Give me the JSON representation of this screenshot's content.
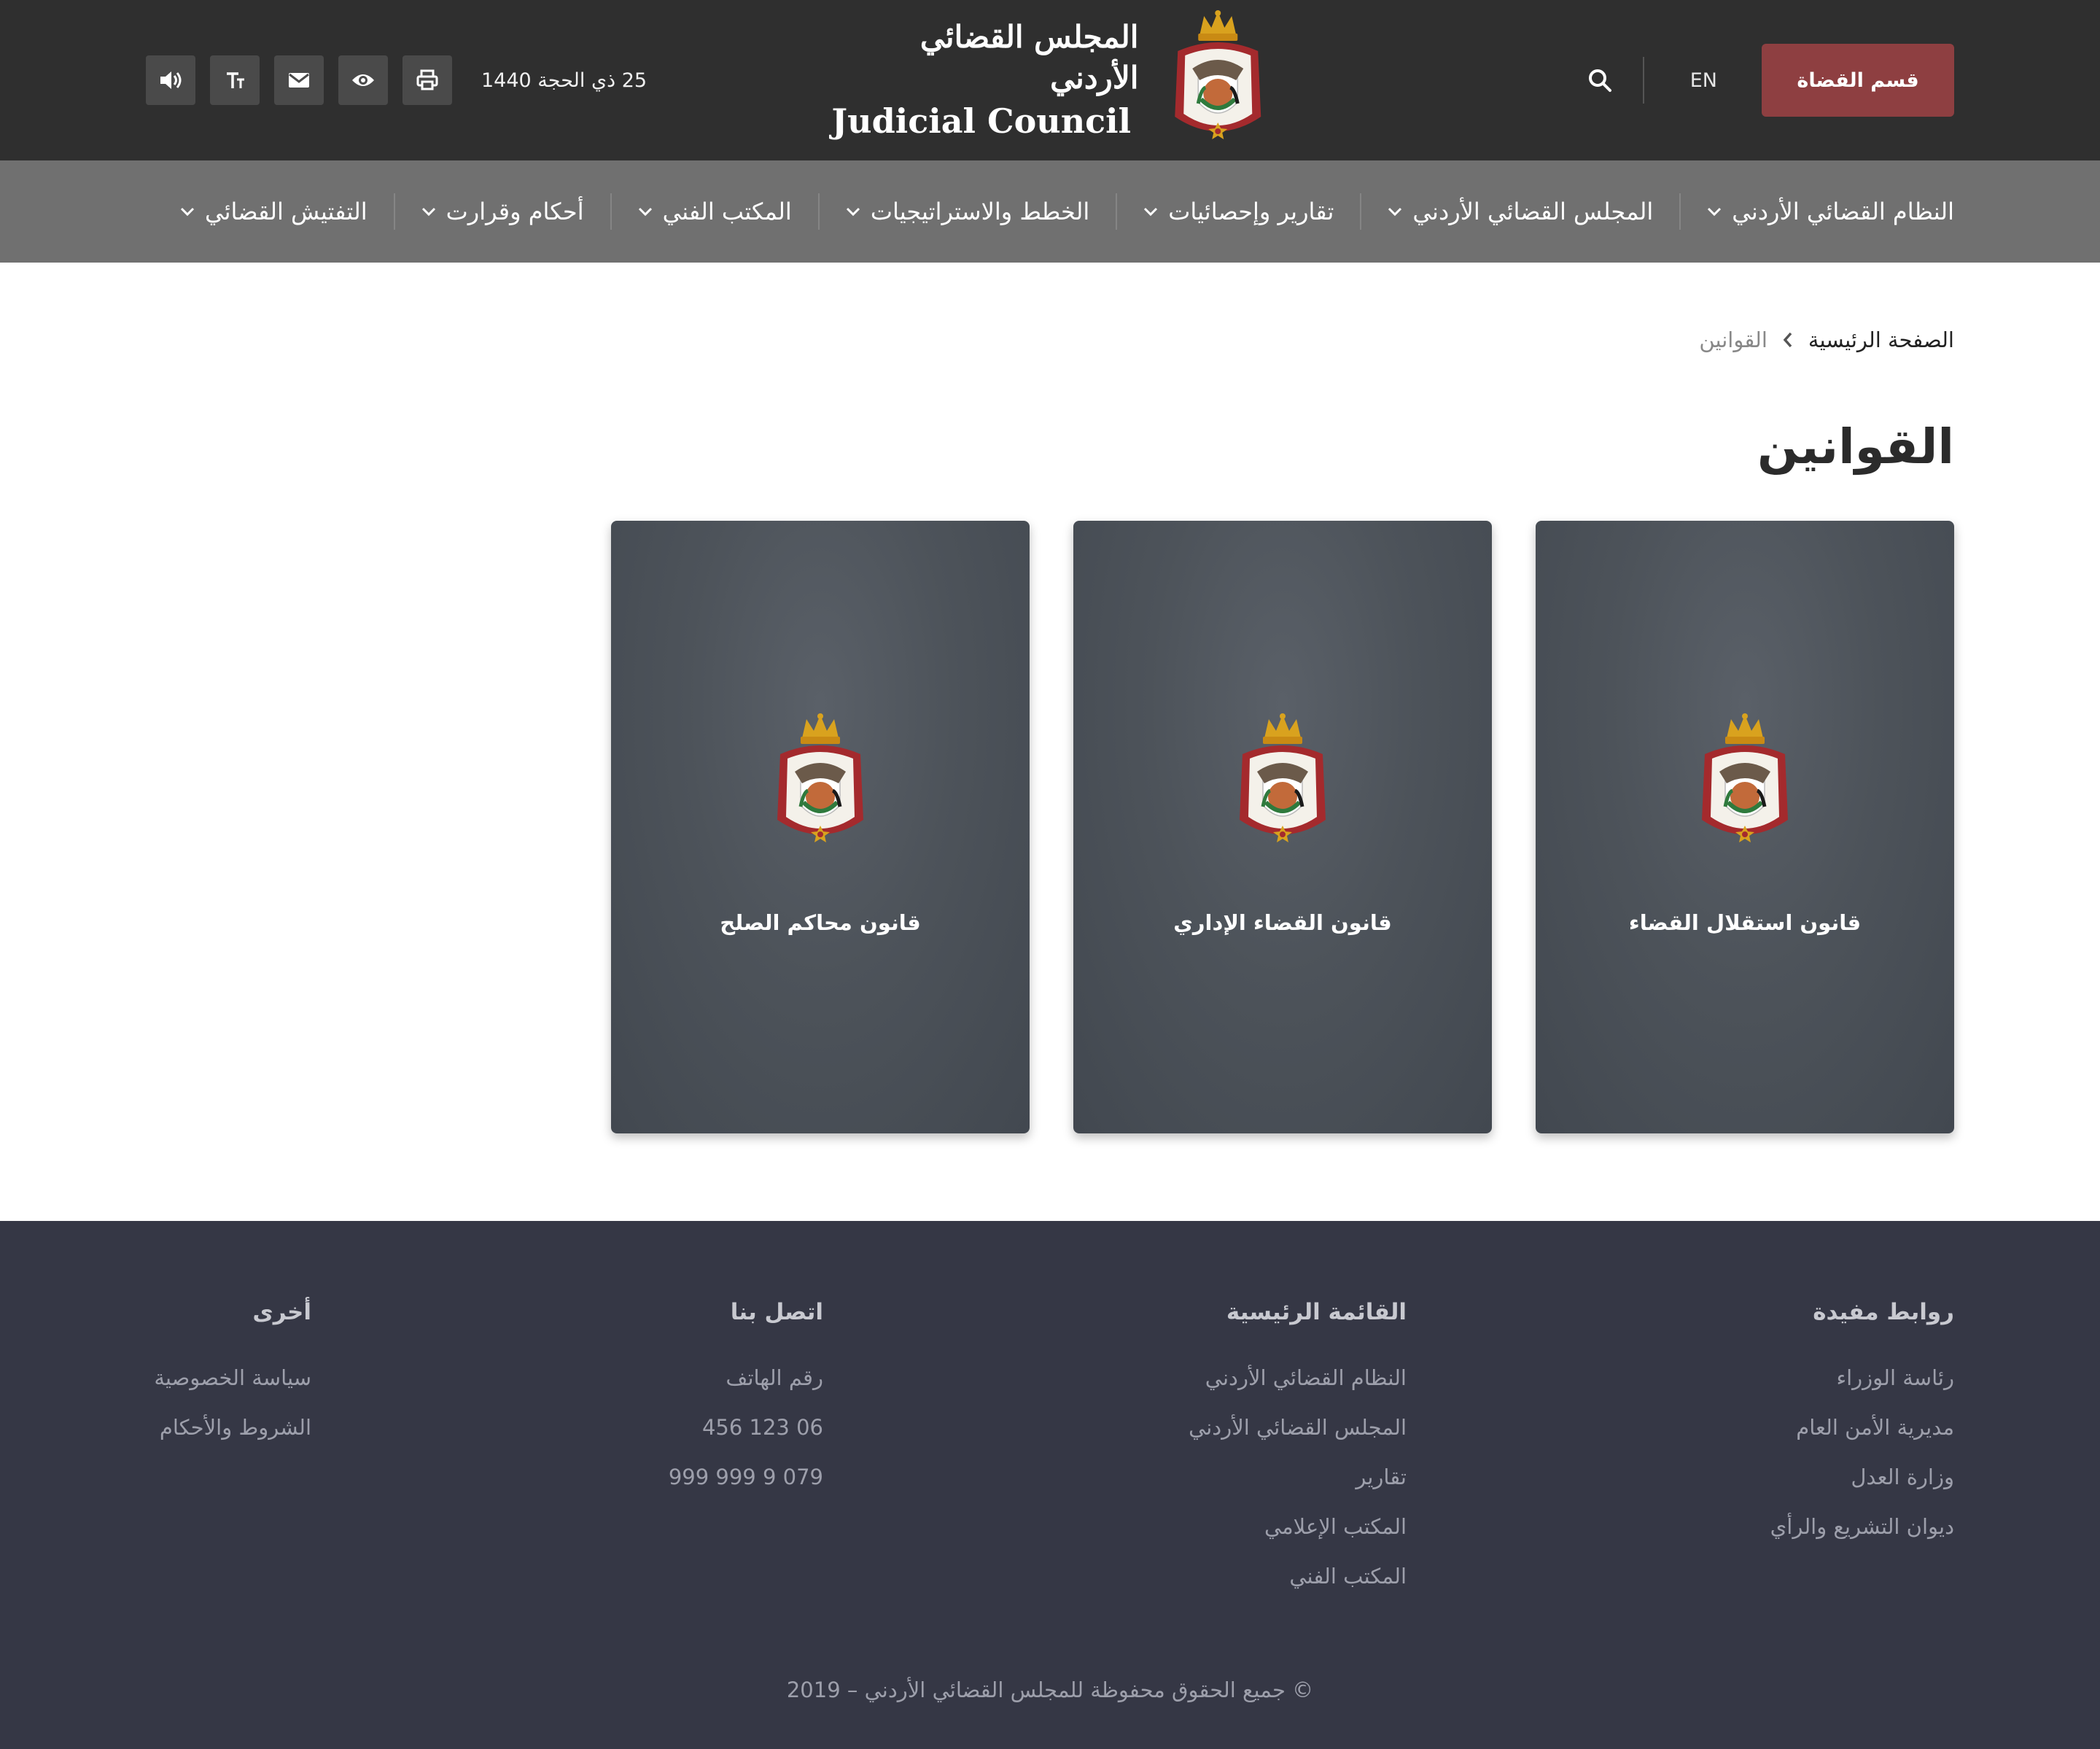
{
  "header": {
    "judges_button": "قسم القضاة",
    "lang": "EN",
    "brand_ar": "المجلس القضائي الأردني",
    "brand_en": "Judicial Council",
    "hijri_date": "25 ذي الحجة 1440",
    "tools": [
      "print-icon",
      "eye-icon",
      "envelope-icon",
      "font-size-icon",
      "speaker-icon"
    ]
  },
  "nav": {
    "items": [
      "النظام القضائي الأردني",
      "المجلس القضائي الأردني",
      "تقارير وإحصائيات",
      "الخطط والاستراتيجيات",
      "المكتب الفني",
      "أحكام وقرارت",
      "التفتيش القضائي"
    ]
  },
  "breadcrumb": {
    "home": "الصفحة الرئيسية",
    "current": "القوانين"
  },
  "page": {
    "title": "القوانين"
  },
  "cards": [
    "قانون استقلال القضاء",
    "قانون القضاء الإداري",
    "قانون محاكم الصلح"
  ],
  "footer": {
    "useful": {
      "heading": "روابط مفيدة",
      "links": [
        "رئاسة الوزراء",
        "مديرية الأمن العام",
        "وزارة العدل",
        "ديوان التشريع والرأي"
      ]
    },
    "mainmenu": {
      "heading": "القائمة الرئيسية",
      "links": [
        "النظام القضائي الأردني",
        "المجلس القضائي الأردني",
        "تقارير",
        "المكتب الإعلامي",
        "المكتب الفني"
      ]
    },
    "contact": {
      "heading": "اتصل بنا",
      "links": [
        "رقم الهاتف",
        "06 123 456",
        "079 9 999 999"
      ]
    },
    "other": {
      "heading": "أخرى",
      "links": [
        "سياسة الخصوصية",
        "الشروط والأحكام"
      ]
    },
    "copyright": "© جميع الحقوق محفوظة للمجلس القضائي الأردني – 2019"
  },
  "colors": {
    "topbar": "#2f2f2f",
    "nav": "#707070",
    "accent": "#8e3f41",
    "footer": "#353745"
  }
}
